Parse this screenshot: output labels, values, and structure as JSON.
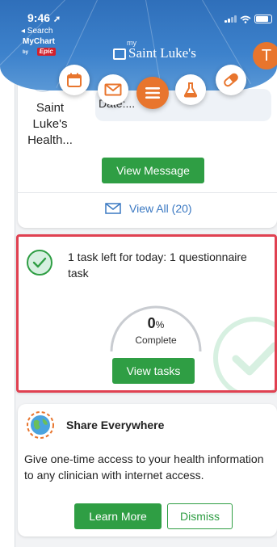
{
  "status_bar": {
    "time": "9:46",
    "back_label": "◂ Search"
  },
  "header": {
    "mychart_text": "MyChart",
    "by_text": "by",
    "epic_text": "Epic",
    "brand_my": "my",
    "brand_name": "Saint Luke's",
    "avatar_initial": "T"
  },
  "quick_actions": [
    "calendar-icon",
    "envelope-icon",
    "menu-icon",
    "flask-icon",
    "pill-icon"
  ],
  "message_card": {
    "org_name": "Saint Luke's Health...",
    "date_label": "Date:...",
    "view_message_label": "View Message",
    "view_all_label": "View All (20)"
  },
  "task_card": {
    "task_text": "1 task left for today: 1 questionnaire task",
    "percent_value": "0",
    "percent_sign": "%",
    "complete_label": "Complete",
    "progress_fraction": 0,
    "view_tasks_label": "View tasks",
    "accent_color": "#2f9e44",
    "highlight_color": "#e04151"
  },
  "share_card": {
    "title": "Share Everywhere",
    "description": "Give one-time access to your health information to any clinician with internet access.",
    "learn_more_label": "Learn More",
    "dismiss_label": "Dismiss"
  },
  "colors": {
    "header_blue": "#3d82cc",
    "brand_orange": "#e8752d",
    "button_green": "#2f9e44",
    "link_blue": "#3a78c2"
  }
}
